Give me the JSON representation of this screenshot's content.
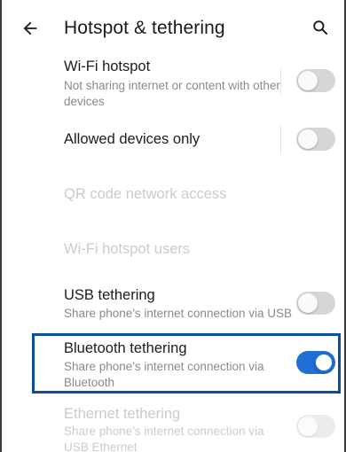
{
  "header": {
    "title": "Hotspot & tethering",
    "back_icon": "arrow-left-icon",
    "search_icon": "search-icon"
  },
  "items": [
    {
      "label": "Wi-Fi hotspot",
      "sub": "Not sharing internet or content with other devices",
      "toggle": "off",
      "enabled": true
    },
    {
      "label": "Allowed devices only",
      "sub": "",
      "toggle": "off",
      "enabled": true
    },
    {
      "label": "QR code network access",
      "sub": "",
      "enabled": false
    },
    {
      "label": "Wi-Fi hotspot users",
      "sub": "",
      "enabled": false
    },
    {
      "label": "USB tethering",
      "sub": "Share phone's internet connection via USB",
      "toggle": "off",
      "enabled": true
    },
    {
      "label": "Bluetooth tethering",
      "sub": "Share phone's internet connection via Bluetooth",
      "toggle": "on",
      "enabled": true,
      "highlighted": true
    },
    {
      "label": "Ethernet tethering",
      "sub": "Share phone's internet connection via USB Ethernet",
      "toggle": "off",
      "enabled": false
    }
  ],
  "colors": {
    "accent": "#1f6fd6",
    "highlight_border": "#0a4f9a",
    "disabled_text": "#cbcbcb",
    "secondary_text": "#8a8a8a"
  }
}
